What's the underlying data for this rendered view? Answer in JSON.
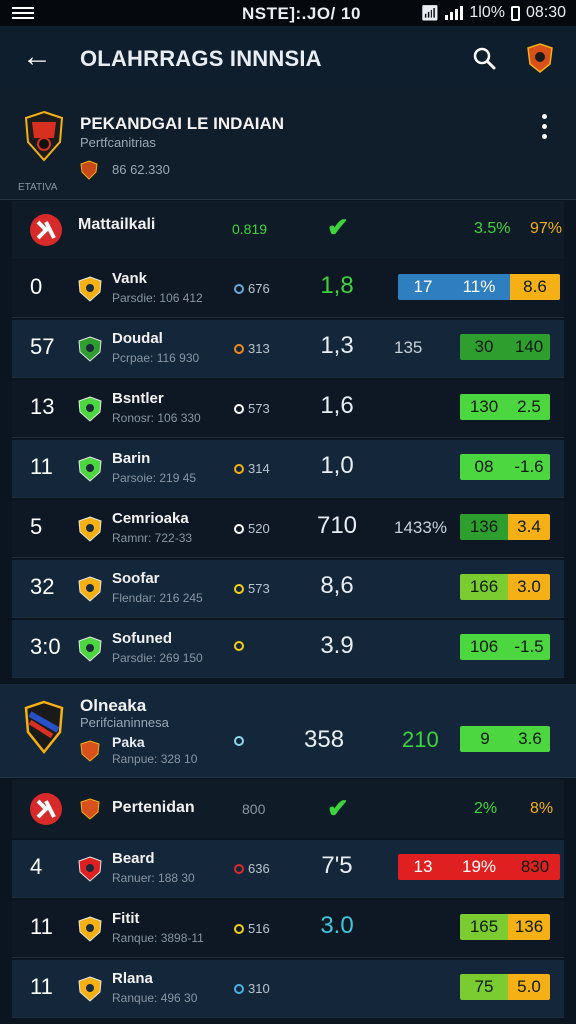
{
  "status": {
    "center": "NSTE]:.JO/ 10",
    "battery": "1l0%",
    "time": "08:30"
  },
  "appbar": {
    "title": "OLAHRRAGS INNNSIA"
  },
  "league1": {
    "name": "PEKANDGAI LE INDAIAN",
    "sub": "Pertfcanitrias",
    "meta": "86 62.330",
    "tag": "ETATIVA"
  },
  "section1": {
    "label": "Mattailkali",
    "val": "0.819",
    "pct1": "3.5%",
    "pct2": "97%"
  },
  "rows": [
    {
      "rank": "0",
      "name": "Vank",
      "sub": "Parsdie: 106 412",
      "dot": "676",
      "dot_color": "#6aa8d8",
      "score": "1,8",
      "mid": "",
      "s1": "17",
      "s2": "11%",
      "s3": "8.6",
      "bar1": "#2f7fc0",
      "bar2": "#2f7fc0",
      "bar3": "#f4b014",
      "score_color": "#3cd43c"
    },
    {
      "rank": "57",
      "name": "Doudal",
      "sub": "Pcrpae: 116 930",
      "dot": "313",
      "dot_color": "#f08a1c",
      "score": "1,3",
      "mid": "135",
      "s1": "",
      "s2": "30",
      "s3": "140",
      "bar1": "#2e9e2e",
      "bar2": "#2e9e2e",
      "bar3": "#2e9e2e",
      "score_color": "#e8eef4"
    },
    {
      "rank": "13",
      "name": "Bsntler",
      "sub": "Ronosr: 106 330",
      "dot": "573",
      "dot_color": "#ffffff",
      "score": "1,6",
      "mid": "",
      "s1": "",
      "s2": "130",
      "s3": "2.5",
      "bar1": "#4cd640",
      "bar2": "#4cd640",
      "bar3": "#4cd640",
      "score_color": "#e8eef4"
    },
    {
      "rank": "11",
      "name": "Barin",
      "sub": "Parsoie: 219 45",
      "dot": "314",
      "dot_color": "#f4b014",
      "score": "1,0",
      "mid": "",
      "s1": "",
      "s2": "08",
      "s3": "-1.6",
      "bar1": "#4cd640",
      "bar2": "#4cd640",
      "bar3": "#4cd640",
      "score_color": "#e8eef4"
    },
    {
      "rank": "5",
      "name": "Cemrioaka",
      "sub": "Ramnr: 722-33",
      "dot": "520",
      "dot_color": "#ffffff",
      "score": "710",
      "mid": "1433%",
      "s1": "",
      "s2": "136",
      "s3": "3.4",
      "bar1": "#2e9e2e",
      "bar2": "#2e9e2e",
      "bar3": "#f4b014",
      "score_color": "#e8eef4"
    },
    {
      "rank": "32",
      "name": "Soofar",
      "sub": "Flendar: 216 245",
      "dot": "573",
      "dot_color": "#f4d014",
      "score": "8,6",
      "mid": "",
      "s1": "",
      "s2": "166",
      "s3": "3.0",
      "bar1": "#7acc30",
      "bar2": "#7acc30",
      "bar3": "#f4b014",
      "score_color": "#e8eef4"
    },
    {
      "rank": "3:0",
      "name": "Sofuned",
      "sub": "Parsdie: 269 150",
      "dot": "",
      "dot_color": "#f4d014",
      "score": "3.9",
      "mid": "",
      "s1": "",
      "s2": "106",
      "s3": "-1.5",
      "bar1": "#4cd640",
      "bar2": "#4cd640",
      "bar3": "#4cd640",
      "score_color": "#e8eef4"
    }
  ],
  "league2": {
    "name": "Olneaka",
    "sub": "Perifcianinnesa",
    "team": "Paka",
    "teamsub": "Ranpue: 328 10",
    "score": "358",
    "mid": "210",
    "s2": "9",
    "s3": "3.6"
  },
  "section2": {
    "label": "Pertenidan",
    "val": "800",
    "pct1": "2%",
    "pct2": "8%"
  },
  "rows2": [
    {
      "rank": "4",
      "name": "Beard",
      "sub": "Ranuer: 188 30",
      "dot": "636",
      "dot_color": "#d82a2a",
      "score": "7'5",
      "mid": "",
      "s1": "13",
      "s2": "19%",
      "s3": "830",
      "bar1": "#e02020",
      "bar2": "#e02020",
      "bar3": "#e02020",
      "score_color": "#e8eef4"
    },
    {
      "rank": "11",
      "name": "Fitit",
      "sub": "Ranque: 3898-11",
      "dot": "516",
      "dot_color": "#f4d014",
      "score": "3.0",
      "mid": "",
      "s1": "",
      "s2": "165",
      "s3": "136",
      "bar1": "#7acc30",
      "bar2": "#7acc30",
      "bar3": "#f4b014",
      "score_color": "#3cc8d8"
    },
    {
      "rank": "11",
      "name": "Rlana",
      "sub": "Ranque: 496 30",
      "dot": "310",
      "dot_color": "#4ab0e8",
      "score": "",
      "mid": "",
      "s1": "",
      "s2": "75",
      "s3": "5.0",
      "bar1": "#7acc30",
      "bar2": "#7acc30",
      "bar3": "#f4b014",
      "score_color": "#e8eef4"
    }
  ]
}
